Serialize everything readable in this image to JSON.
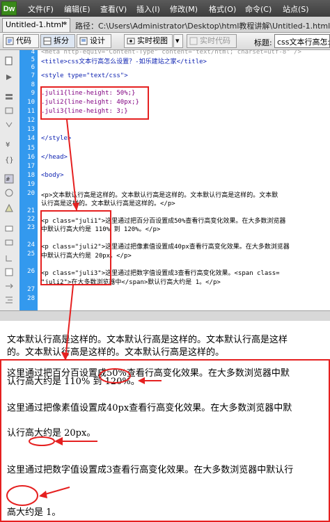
{
  "app": {
    "logo": "Dw",
    "menu": [
      "文件(F)",
      "编辑(E)",
      "查看(V)",
      "插入(I)",
      "修改(M)",
      "格式(O)",
      "命令(C)",
      "站点(S)"
    ]
  },
  "tabs": {
    "doc_tab": "Untitled-1.html*",
    "close": "×",
    "path": "路径：C:\\Users\\Administrator\\Desktop\\html教程讲解\\Untitled-1.html"
  },
  "toolbar": {
    "code": "代码",
    "split": "拆分",
    "design": "设计",
    "live_view": "实时视图",
    "live_code": "实时代码",
    "title_label": "标题:",
    "title_value": "css文本行高怎么设置？"
  },
  "code": {
    "line_numbers": [
      "4",
      "5",
      "6",
      "7",
      "8",
      "9",
      "10",
      "11",
      "12",
      "13",
      "14",
      "15",
      "16",
      "17",
      "18",
      "19",
      "20",
      "21",
      "22",
      "23",
      "24",
      "25",
      "26",
      "27",
      "28"
    ],
    "line4": "<meta http-equiv=\"Content-Type\" content=\"text/html; charset=utf-8\" />",
    "line5": "<title>css文本行高怎么设置？-如乐建站之家</title>",
    "line7": "<style type=\"text/css\">",
    "line9": ".juli1{line-height: 50%;}",
    "line10": ".juli2{line-height: 40px;}",
    "line11": ".juli3{line-height: 3;}",
    "line14": "</style>",
    "line16": "</head>",
    "line18": "<body>",
    "line20a": "<p>文本默认行高是这样的。文本默认行高是这样的。文本默认行高是这样的。文本默",
    "line20b": "认行高是这样的。文本默认行高是这样的。</p>",
    "line22a": "<p class=\"juli1\">这里通过把百分百设置成50%查看行高变化效果。在大多数浏览器",
    "line22b": "中默认行高大约是 110% 到 120%。</p>",
    "line24a": "<p class=\"juli2\">这里通过把像素值设置成40px查看行高变化效果。在大多数浏览器",
    "line24b": "中默认行高大约是 20px。</p>",
    "line26a": "<p class=\"juli3\">这里通过把数字值设置成3查看行高变化效果。<span class=",
    "line26b": "\"juli2\">在大多数浏览器中</span>默认行高大约是 1。</p>"
  },
  "preview": {
    "p1a": "文本默认行高是这样的。文本默认行高是这样的。文本默认行高是这样",
    "p1b": "的。文本默认行高是这样的。文本默认行高是这样的。",
    "p2a": "这里通过把百分百设置成50%查看行高变化效果。在大多数浏览器中默",
    "p2b": "认行高大约是 110% 到 120%。",
    "p3a": "这里通过把像素值设置成40px查看行高变化效果。在大多数浏览器中默",
    "p3b": "认行高大约是 20px。",
    "p4a": "这里通过把数字值设置成3查看行高变化效果。在大多数浏览器中默认行",
    "p4b": "高大约是 1。"
  },
  "colors": {
    "annotation": "#e52020",
    "gutter": "#3399ee",
    "tag": "#0a1fb0"
  }
}
